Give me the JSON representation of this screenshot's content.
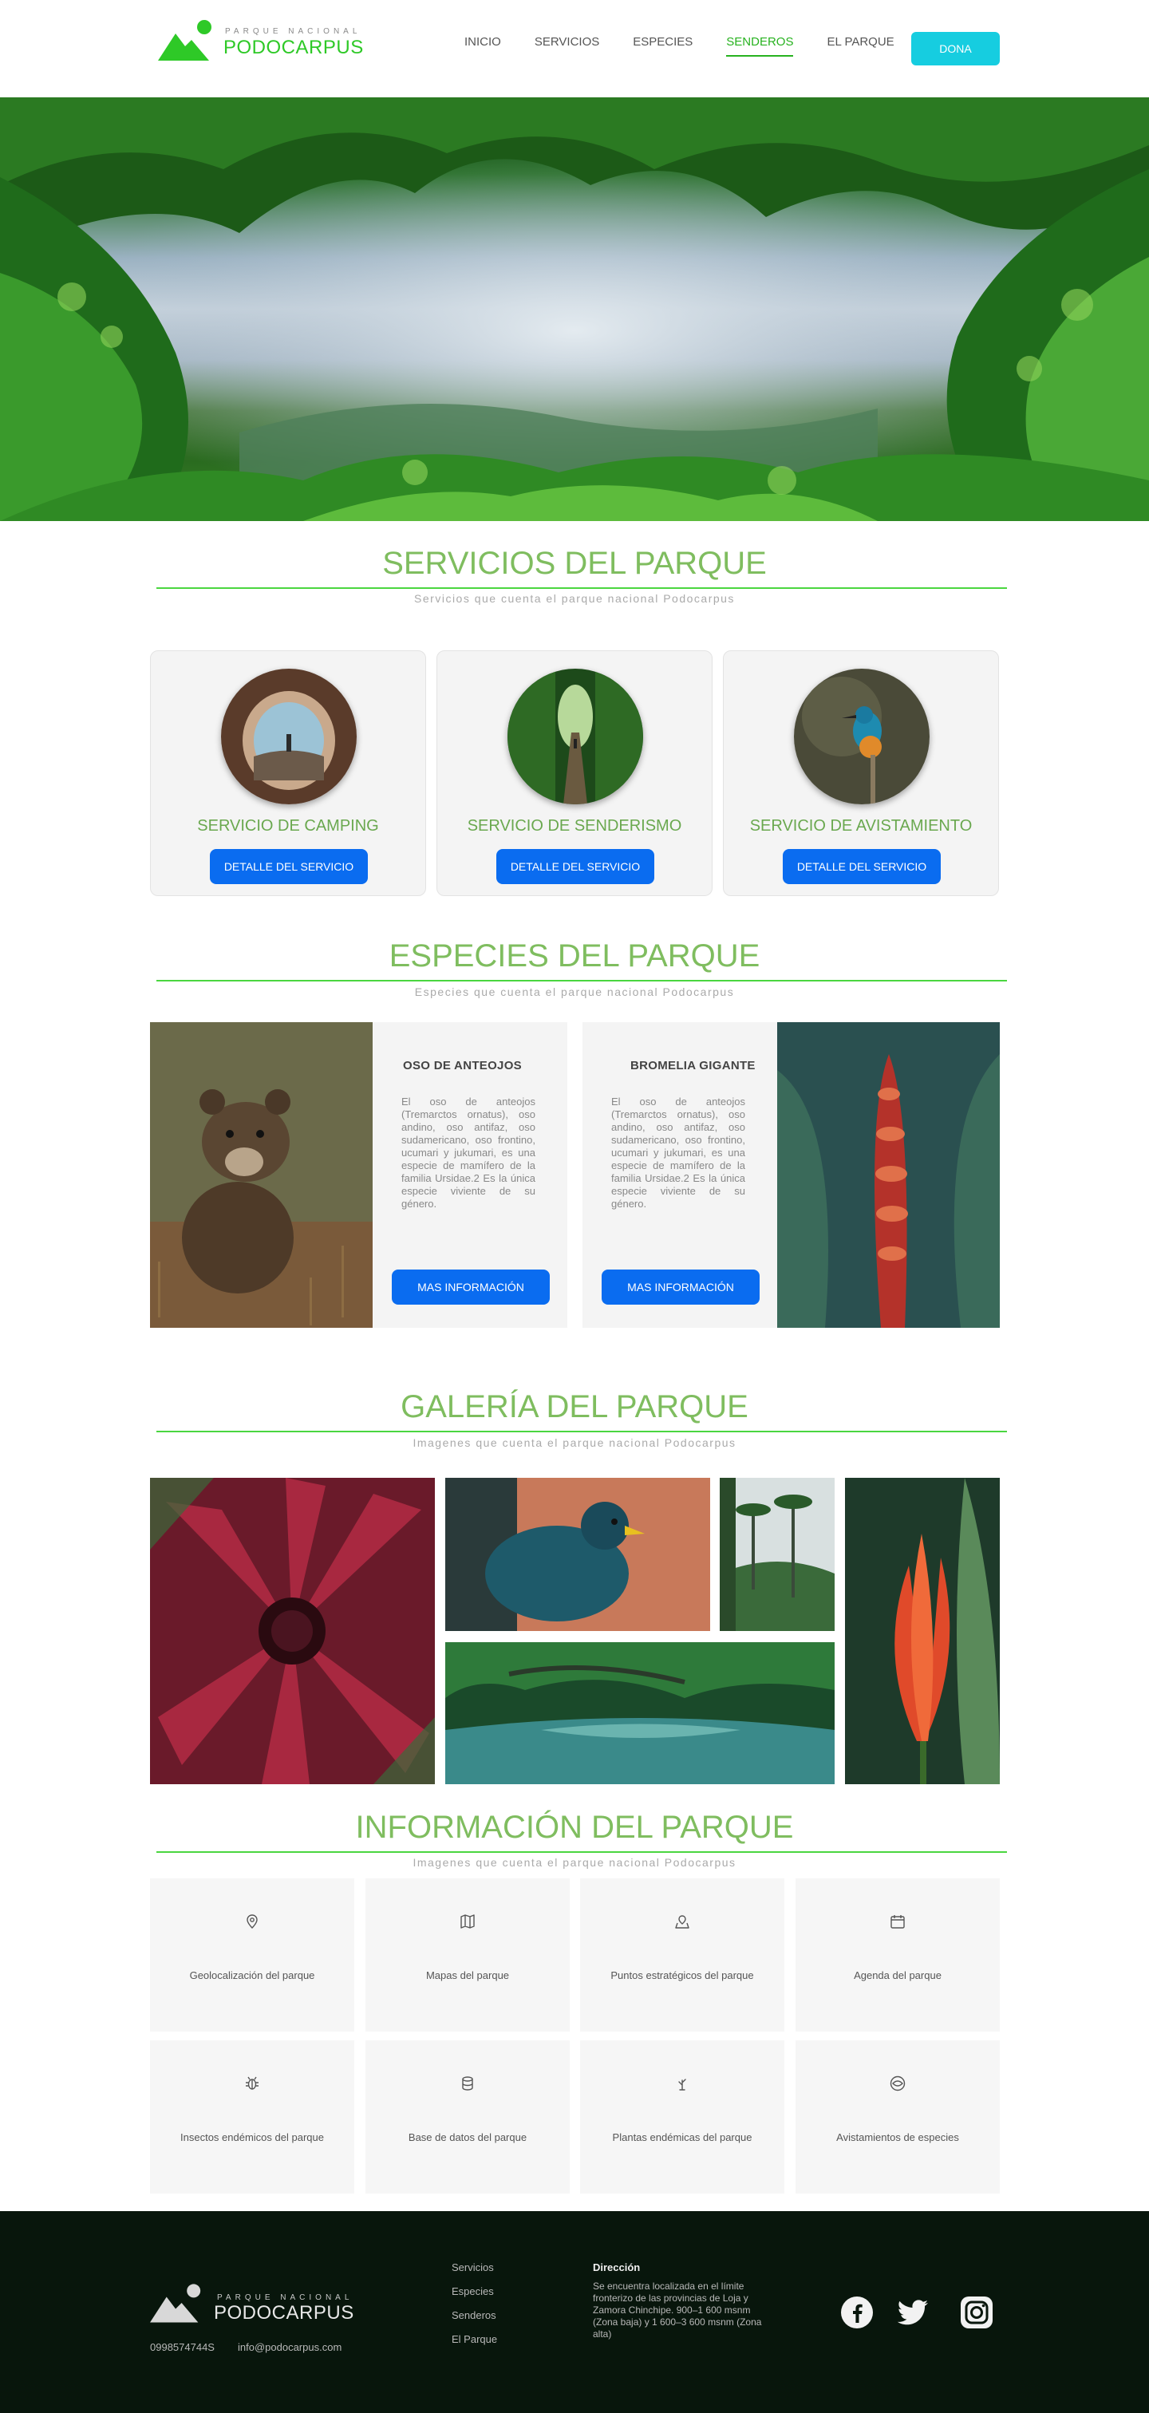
{
  "header": {
    "logo_small": "PARQUE NACIONAL",
    "logo_big": "PODOCARPUS",
    "nav": [
      "INICIO",
      "SERVICIOS",
      "ESPECIES",
      "SENDEROS",
      "EL PARQUE"
    ],
    "active_nav": "SENDEROS",
    "donate_label": "DONA"
  },
  "services": {
    "title": "SERVICIOS DEL PARQUE",
    "subtitle": "Servicios que cuenta el parque nacional Podocarpus",
    "cards": [
      {
        "title": "SERVICIO DE CAMPING",
        "button": "DETALLE DEL SERVICIO"
      },
      {
        "title": "SERVICIO DE SENDERISMO",
        "button": "DETALLE DEL SERVICIO"
      },
      {
        "title": "SERVICIO DE AVISTAMIENTO",
        "button": "DETALLE DEL SERVICIO"
      }
    ]
  },
  "species": {
    "title": "ESPECIES DEL PARQUE",
    "subtitle": "Especies que cuenta el parque nacional Podocarpus",
    "cards": [
      {
        "name": "OSO DE ANTEOJOS",
        "description": "El oso de anteojos (Tremarctos ornatus), oso andino, oso antifaz, oso sudamericano, oso frontino, ucumari y jukumari, es una especie de mamífero de la familia Ursidae.2 Es la única especie viviente de su género.",
        "button": "MAS INFORMACIÓN"
      },
      {
        "name": "BROMELIA GIGANTE",
        "description": "El oso de anteojos (Tremarctos ornatus), oso andino, oso antifaz, oso sudamericano, oso frontino, ucumari y jukumari, es una especie de mamífero de la familia Ursidae.2 Es la única especie viviente de su género.",
        "button": "MAS INFORMACIÓN"
      }
    ]
  },
  "gallery": {
    "title": "GALERÍA DEL PARQUE",
    "subtitle": "Imagenes que cuenta el parque nacional Podocarpus"
  },
  "info": {
    "title": "INFORMACIÓN DEL PARQUE",
    "subtitle": "Imagenes que cuenta el parque nacional Podocarpus",
    "tiles": [
      {
        "label": "Geolocalización del parque",
        "icon": "map-pin-icon"
      },
      {
        "label": "Mapas del parque",
        "icon": "map-icon"
      },
      {
        "label": "Puntos estratégicos del parque",
        "icon": "map-pin-outline-icon"
      },
      {
        "label": "Agenda del parque",
        "icon": "calendar-icon"
      },
      {
        "label": "Insectos endémicos del parque",
        "icon": "bug-icon"
      },
      {
        "label": "Base de datos del parque",
        "icon": "database-icon"
      },
      {
        "label": "Plantas endémicas del parque",
        "icon": "plant-icon"
      },
      {
        "label": "Avistamientos de especies",
        "icon": "eye-icon"
      }
    ]
  },
  "footer": {
    "logo_small": "PARQUE NACIONAL",
    "logo_big": "PODOCARPUS",
    "phone": "0998574744S",
    "email": "info@podocarpus.com",
    "links": [
      "Servicios",
      "Especies",
      "Senderos",
      "El Parque"
    ],
    "address_title": "Dirección",
    "address_text": "Se encuentra localizada en el límite fronterizo de las provincias de Loja y Zamora Chinchipe. 900–1 600 msnm (Zona baja) y 1 600–3 600 msnm (Zona alta)"
  },
  "colors": {
    "brand_green": "#2ec927",
    "title_green": "#7fbd5f",
    "primary_blue": "#0a6cf0",
    "donate_cyan": "#16cde0",
    "footer_bg": "#08160c"
  }
}
